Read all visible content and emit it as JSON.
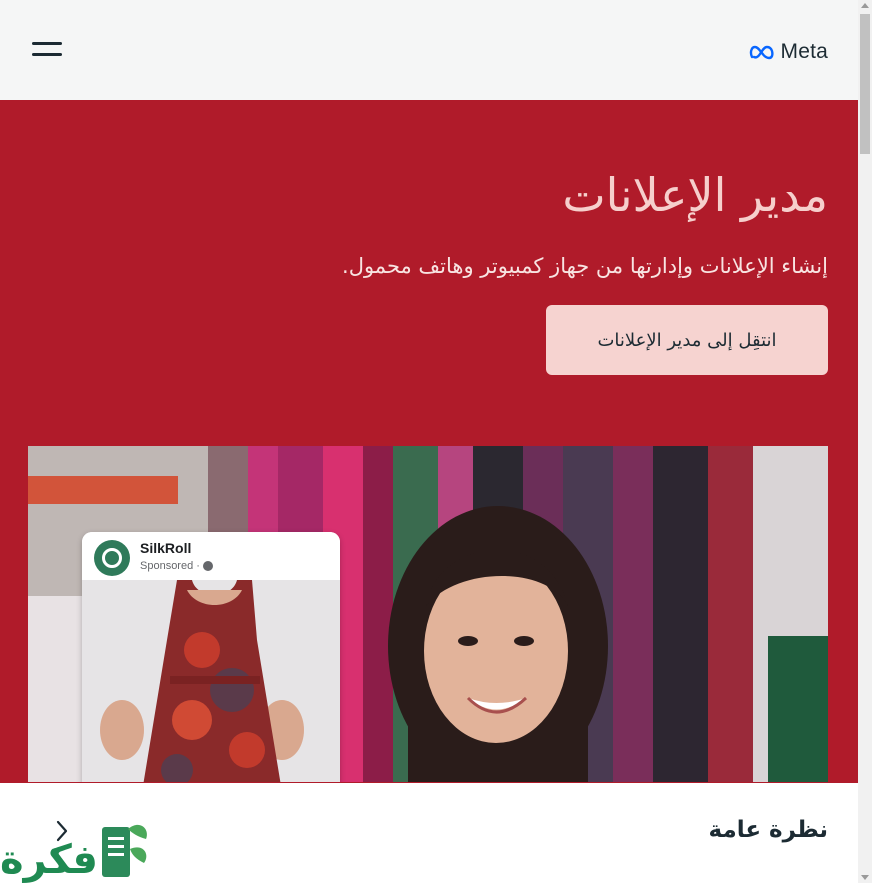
{
  "header": {
    "logo_text": "Meta",
    "menu_icon": "hamburger-menu-icon",
    "background": "#f5f6f6"
  },
  "hero": {
    "title": "مدير الإعلانات",
    "subtitle": "إنشاء الإعلانات وإدارتها من جهاز كمبيوتر وهاتف محمول.",
    "cta_label": "انتقِل إلى مدير الإعلانات",
    "background": "#b01b2a",
    "cta_background": "#f6d3d0"
  },
  "ad_preview": {
    "page_name": "SilkRoll",
    "sponsored_label": "Sponsored ·"
  },
  "overview": {
    "title": "نظرة عامة",
    "nav_icon": "chevron-left-icon"
  },
  "watermark": {
    "text": "فكرة"
  }
}
